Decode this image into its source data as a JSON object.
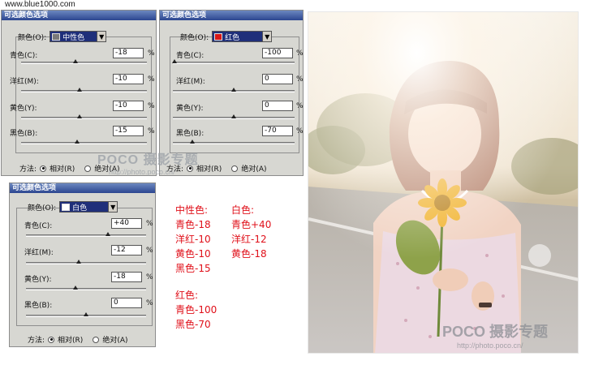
{
  "site_url": "www.blue1000.com",
  "panels": [
    {
      "title": "可选颜色选项",
      "color_label": "颜色(O):",
      "color_value": "中性色",
      "swatch_color": "#7a7a7a",
      "sliders": [
        {
          "label": "青色(C):",
          "value": "-18",
          "level": -0.18
        },
        {
          "label": "洋红(M):",
          "value": "-10",
          "level": -0.1
        },
        {
          "label": "黄色(Y):",
          "value": "-10",
          "level": -0.1
        },
        {
          "label": "黑色(B):",
          "value": "-15",
          "level": -0.15
        }
      ],
      "percent": "%",
      "method_label": "方法:",
      "method_relative": "相对(R)",
      "method_absolute": "绝对(A)"
    },
    {
      "title": "可选颜色选项",
      "color_label": "颜色(O):",
      "color_value": "红色",
      "swatch_color": "#d81818",
      "sliders": [
        {
          "label": "青色(C):",
          "value": "-100",
          "level": -1.0
        },
        {
          "label": "洋红(M):",
          "value": "0",
          "level": 0
        },
        {
          "label": "黄色(Y):",
          "value": "0",
          "level": 0
        },
        {
          "label": "黑色(B):",
          "value": "-70",
          "level": -0.7
        }
      ],
      "percent": "%",
      "method_label": "方法:",
      "method_relative": "相对(R)",
      "method_absolute": "绝对(A)"
    },
    {
      "title": "可选颜色选项",
      "color_label": "颜色(O):",
      "color_value": "白色",
      "swatch_color": "#ffffff",
      "sliders": [
        {
          "label": "青色(C):",
          "value": "+40",
          "level": 0.4
        },
        {
          "label": "洋红(M):",
          "value": "-12",
          "level": -0.12
        },
        {
          "label": "黄色(Y):",
          "value": "-18",
          "level": -0.18
        },
        {
          "label": "黑色(B):",
          "value": "0",
          "level": 0
        }
      ],
      "percent": "%",
      "method_label": "方法:",
      "method_relative": "相对(R)",
      "method_absolute": "绝对(A)"
    }
  ],
  "watermark": {
    "brand": "POCO 摄影专题",
    "url": "http://photo.poco.cn/"
  },
  "notes": {
    "neutral": [
      "中性色:",
      "青色-18",
      "洋红-10",
      "黄色-10",
      "黑色-15"
    ],
    "white": [
      "白色:",
      "青色+40",
      "洋红-12",
      "黄色-18"
    ],
    "red": [
      "红色:",
      "青色-100",
      "黑色-70"
    ]
  },
  "photo_watermark": {
    "brand": "POCO 摄影专题",
    "url": "http://photo.poco.cn/"
  },
  "colors": {
    "title_bar": "#2c4690",
    "notes_text": "#e0101a",
    "panel_bg": "#d7d7d2"
  }
}
